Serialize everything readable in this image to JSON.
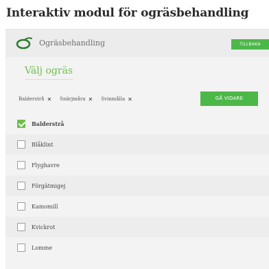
{
  "page": {
    "title": "Interaktiv modul för ogräsbehandling"
  },
  "header": {
    "title": "Ogräsbehandling",
    "back_label": "TILLBAKA"
  },
  "section": {
    "title": "Välj ogräs"
  },
  "selected_tags": [
    {
      "label": "Balderstrå"
    },
    {
      "label": "Snärjmåra"
    },
    {
      "label": "Svinmålla"
    }
  ],
  "next_label": "GÅ VIDARE",
  "weeds": [
    {
      "label": "Balderstrå",
      "checked": true
    },
    {
      "label": "Blåklint",
      "checked": false
    },
    {
      "label": "Flyghavre",
      "checked": false
    },
    {
      "label": "Förgätmigej",
      "checked": false
    },
    {
      "label": "Kamomill",
      "checked": false
    },
    {
      "label": "Kvickrot",
      "checked": false
    },
    {
      "label": "Lomme",
      "checked": false
    }
  ],
  "colors": {
    "accent": "#4cb848",
    "accent_light": "#6cc04a"
  }
}
